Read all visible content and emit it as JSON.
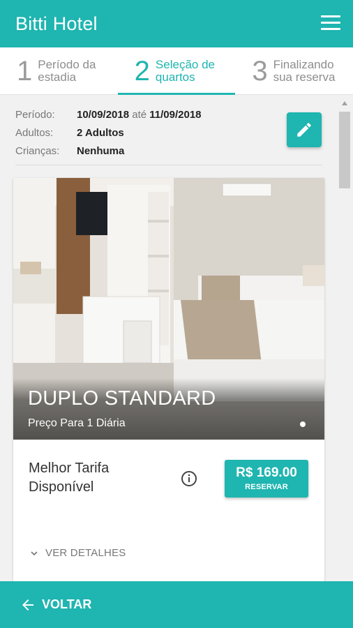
{
  "app": {
    "title": "Bitti Hotel"
  },
  "steps": [
    {
      "num": "1",
      "line1": "Período da",
      "line2": "estadia"
    },
    {
      "num": "2",
      "line1": "Seleção de",
      "line2": "quartos"
    },
    {
      "num": "3",
      "line1": "Finalizando",
      "line2": "sua reserva"
    }
  ],
  "summary": {
    "period_label": "Período:",
    "period_from": "10/09/2018",
    "period_sep": "até",
    "period_to": "11/09/2018",
    "adults_label": "Adultos:",
    "adults_value": "2 Adultos",
    "children_label": "Crianças:",
    "children_value": "Nenhuma"
  },
  "room": {
    "name": "DUPLO STANDARD",
    "subtitle": "Preço Para 1 Diária",
    "rate_line1": "Melhor Tarifa",
    "rate_line2": "Disponível",
    "price": "R$ 169.00",
    "book_label": "RESERVAR",
    "details_label": "VER DETALHES"
  },
  "footer": {
    "back_label": "VOLTAR"
  },
  "colors": {
    "accent": "#1fb5b0"
  },
  "icons": [
    "menu-icon",
    "edit-pencil-icon",
    "info-icon",
    "chevron-down-icon",
    "arrow-left-icon",
    "scroll-up-icon"
  ]
}
